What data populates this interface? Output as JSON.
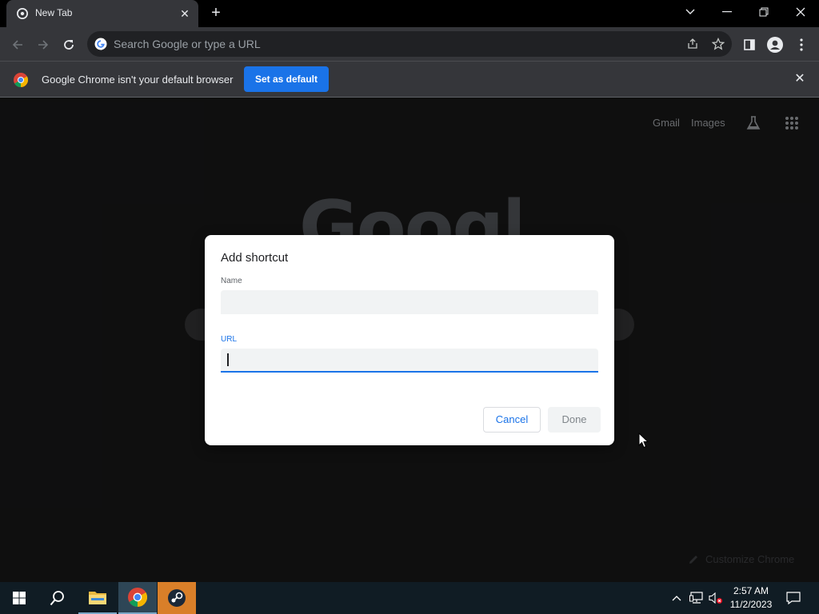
{
  "browser": {
    "tab_title": "New Tab",
    "omnibox_placeholder": "Search Google or type a URL"
  },
  "infobar": {
    "message": "Google Chrome isn't your default browser",
    "button": "Set as default"
  },
  "page": {
    "links": {
      "gmail": "Gmail",
      "images": "Images"
    },
    "logo": "Google",
    "customize": "Customize Chrome"
  },
  "dialog": {
    "title": "Add shortcut",
    "name_label": "Name",
    "name_value": "",
    "url_label": "URL",
    "url_value": "",
    "cancel": "Cancel",
    "done": "Done"
  },
  "taskbar": {
    "time": "2:57 AM",
    "date": "11/2/2023"
  },
  "colors": {
    "accent": "#1a73e8",
    "toolbar": "#35363a",
    "page_bg": "#1c1c1d"
  }
}
